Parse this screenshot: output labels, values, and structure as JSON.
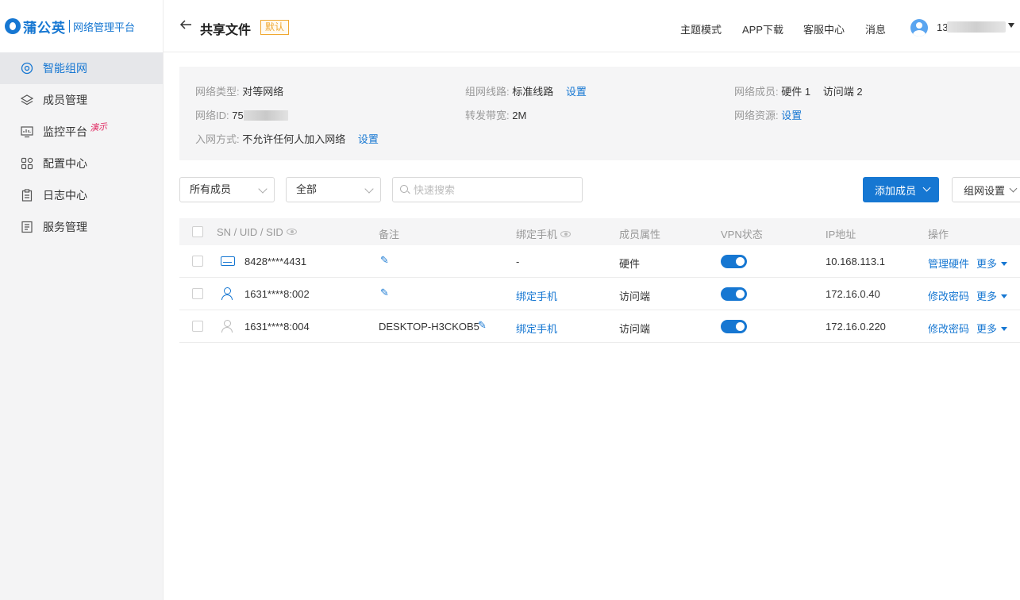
{
  "brand": {
    "name": "蒲公英",
    "subtitle": "网络管理平台"
  },
  "sidebar": {
    "items": [
      {
        "label": "智能组网",
        "icon": "network-icon",
        "active": true
      },
      {
        "label": "成员管理",
        "icon": "layers-icon"
      },
      {
        "label": "监控平台",
        "icon": "monitor-icon",
        "tag": "演示"
      },
      {
        "label": "配置中心",
        "icon": "grid-icon"
      },
      {
        "label": "日志中心",
        "icon": "clipboard-icon"
      },
      {
        "label": "服务管理",
        "icon": "document-icon"
      }
    ]
  },
  "header": {
    "title": "共享文件",
    "badge": "默认",
    "links": [
      "主题模式",
      "APP下载",
      "客服中心",
      "消息"
    ],
    "user_prefix": "13"
  },
  "info": {
    "network_type_label": "网络类型:",
    "network_type": "对等网络",
    "route_label": "组网线路:",
    "route": "标准线路",
    "route_action": "设置",
    "members_label": "网络成员:",
    "members_hardware": "硬件 1",
    "members_visitor": "访问端 2",
    "network_id_label": "网络ID:",
    "network_id_prefix": "75",
    "bandwidth_label": "转发带宽:",
    "bandwidth": "2M",
    "resources_label": "网络资源:",
    "resources_action": "设置",
    "join_label": "入网方式:",
    "join_value": "不允许任何人加入网络",
    "join_action": "设置"
  },
  "filters": {
    "member_select": "所有成员",
    "status_select": "全部",
    "search_placeholder": "快速搜索",
    "add_button": "添加成员",
    "settings_button": "组网设置"
  },
  "table": {
    "columns": [
      "SN / UID / SID",
      "备注",
      "绑定手机",
      "成员属性",
      "VPN状态",
      "IP地址",
      "操作"
    ],
    "rows": [
      {
        "id": "8428****4431",
        "icon": "device-icon",
        "note": "",
        "phone": "-",
        "phone_link": false,
        "type": "硬件",
        "vpn_on": true,
        "ip": "10.168.113.1",
        "action": "管理硬件",
        "more": "更多"
      },
      {
        "id": "1631****8:002",
        "icon": "user-icon",
        "note": "",
        "phone": "绑定手机",
        "phone_link": true,
        "type": "访问端",
        "vpn_on": true,
        "ip": "172.16.0.40",
        "action": "修改密码",
        "more": "更多"
      },
      {
        "id": "1631****8:004",
        "icon": "user-icon",
        "note": "DESKTOP-H3CKOB5",
        "phone": "绑定手机",
        "phone_link": true,
        "type": "访问端",
        "vpn_on": true,
        "ip": "172.16.0.220",
        "action": "修改密码",
        "more": "更多"
      }
    ]
  },
  "colors": {
    "accent": "#1677d2",
    "badge": "#f0a830",
    "demo_tag": "#e0245e"
  }
}
